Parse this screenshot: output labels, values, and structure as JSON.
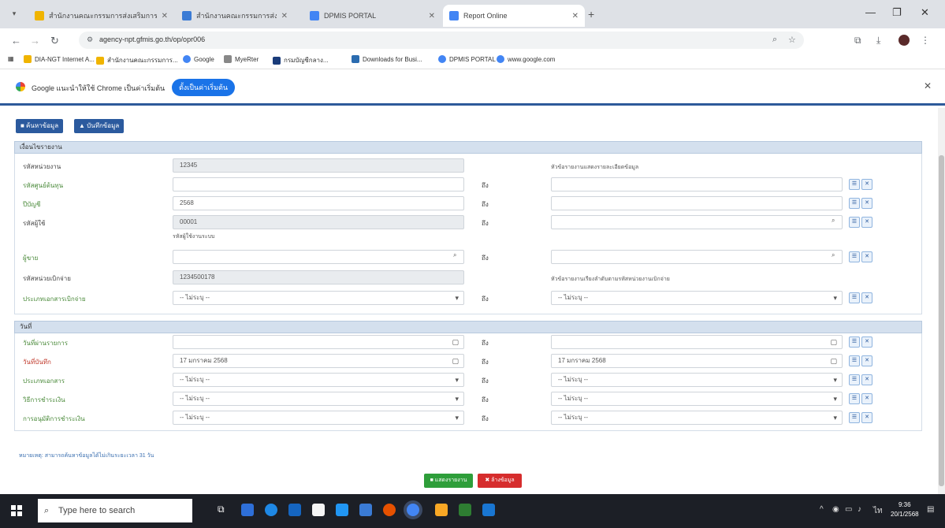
{
  "browser": {
    "tabs": [
      {
        "title": "สำนักงานคณะกรรมการส่งเสริมการลงทุน",
        "fav": "#f0b400"
      },
      {
        "title": "สำนักงานคณะกรรมการส่งเสริมการลงทุน",
        "fav": "#3a7bd5"
      },
      {
        "title": "DPMIS PORTAL",
        "fav": "#4285f4"
      },
      {
        "title": "Report Online",
        "fav": "#4285f4"
      }
    ],
    "url": "agency-npt.gfmis.go.th/op/opr006",
    "bookmarks": [
      "DIA-NGT Internet A...",
      "สำนักงานคณะกรรมการ...",
      "Google",
      "MyeRter",
      "กรมบัญชีกลาง...",
      "Downloads for Busi...",
      "DPMIS PORTAL",
      "www.google.com"
    ]
  },
  "infobar": {
    "message": "Google แนะนำให้ใช้ Chrome เป็นค่าเริ่มต้น",
    "button": "ตั้งเป็นค่าเริ่มต้น"
  },
  "toolbar": {
    "btn1": "■ ค้นหาข้อมูล",
    "btn2": "▲ บันทึกข้อมูล"
  },
  "section1": {
    "title": "เงื่อนไขรายงาน",
    "rows": [
      {
        "label": "รหัสหน่วยงาน",
        "value": "12345",
        "to": "",
        "right": "",
        "note_right": "หัวข้อรายงานแสดงรายละเอียดข้อมูล"
      },
      {
        "label": "รหัสศูนย์ต้นทุน",
        "value": "",
        "to": "ถึง",
        "right": ""
      },
      {
        "label": "ปีบัญชี",
        "value": "2568",
        "to": "ถึง",
        "right": ""
      },
      {
        "label": "รหัสผู้ใช้",
        "value": "00001",
        "to": "ถึง",
        "right": "",
        "note_left": "รหัสผู้ใช้งานระบบ"
      },
      {
        "label": "ผู้ขาย",
        "value": "",
        "to": "ถึง",
        "right": ""
      },
      {
        "label": "รหัสหน่วยเบิกจ่าย",
        "value": "1234500178",
        "to": "",
        "right": "",
        "note_right": "หัวข้อรายงานเรียงลำดับตามรหัสหน่วยงานเบิกจ่าย"
      },
      {
        "label": "ประเภทเอกสารเบิกจ่าย",
        "value": "-- ไม่ระบุ --",
        "to": "ถึง",
        "right": "-- ไม่ระบุ --"
      }
    ]
  },
  "section2": {
    "title": "วันที่",
    "rows": [
      {
        "label": "วันที่ผ่านรายการ",
        "value": "",
        "to": "ถึง",
        "right": ""
      },
      {
        "label": "วันที่บันทึก",
        "value": "17 มกราคม 2568",
        "to": "ถึง",
        "right": "17 มกราคม 2568"
      },
      {
        "label": "ประเภทเอกสาร",
        "value": "-- ไม่ระบุ --",
        "to": "ถึง",
        "right": "-- ไม่ระบุ --"
      },
      {
        "label": "วิธีการชำระเงิน",
        "value": "-- ไม่ระบุ --",
        "to": "ถึง",
        "right": "-- ไม่ระบุ --"
      },
      {
        "label": "การอนุมัติการชำระเงิน",
        "value": "-- ไม่ระบุ --",
        "to": "ถึง",
        "right": "-- ไม่ระบุ --"
      }
    ]
  },
  "footer": {
    "note": "หมายเหตุ: สามารถค้นหาข้อมูลได้ไม่เกินระยะเวลา 31 วัน",
    "search_btn": "■ แสดงรายงาน",
    "clear_btn": "✖ ล้างข้อมูล"
  },
  "taskbar": {
    "search_placeholder": "Type here to search",
    "time": "9:36",
    "date": "20/1/2568",
    "apps": [
      "#2e6fd8",
      "#1e88e5",
      "#1565c0",
      "#f5f5f5",
      "#2196f3",
      "#3a7bd5",
      "#e65100",
      "#4285f4",
      "#f9a825",
      "#2e7d32",
      "#1976d2"
    ]
  }
}
